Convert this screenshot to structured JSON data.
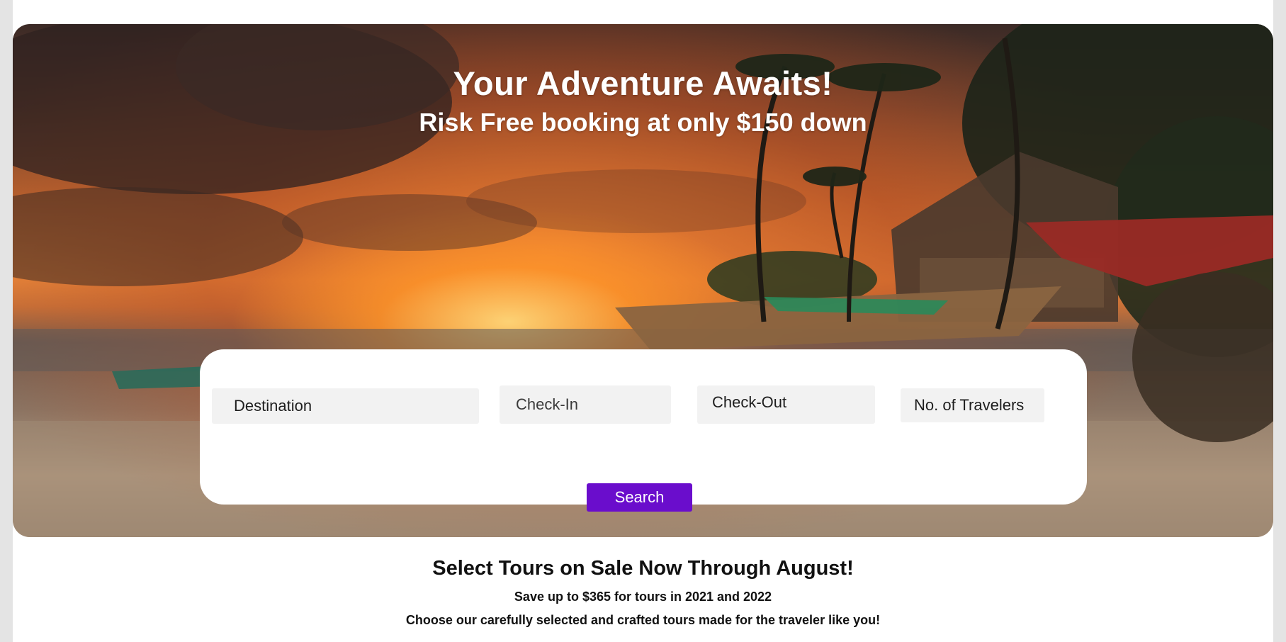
{
  "hero": {
    "title": "Your Adventure Awaits!",
    "subtitle": "Risk Free booking at only $150 down",
    "image": "sunset-beach-palm-trees-boats"
  },
  "search": {
    "destination": "Destination",
    "check_in": "Check-In",
    "check_out": "Check-Out",
    "travelers": "No. of Travelers",
    "button_label": "Search"
  },
  "promo": {
    "title": "Select Tours on Sale Now Through August!",
    "line1": "Save up to $365 for tours in 2021 and 2022",
    "line2": "Choose our carefully selected and crafted tours made for the traveler like you!"
  },
  "colors": {
    "accent": "#6a0dcc",
    "field_bg": "#f2f2f2",
    "text": "#111111"
  }
}
